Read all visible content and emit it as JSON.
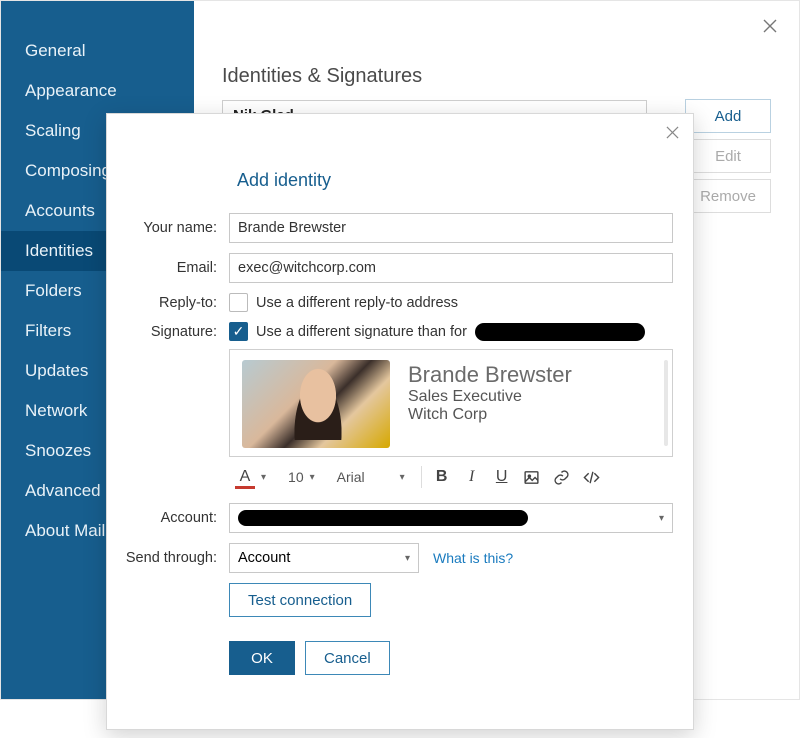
{
  "sidebar": {
    "items": [
      {
        "label": "General"
      },
      {
        "label": "Appearance"
      },
      {
        "label": "Scaling"
      },
      {
        "label": "Composing"
      },
      {
        "label": "Accounts"
      },
      {
        "label": "Identities"
      },
      {
        "label": "Folders"
      },
      {
        "label": "Filters"
      },
      {
        "label": "Updates"
      },
      {
        "label": "Network"
      },
      {
        "label": "Snoozes"
      },
      {
        "label": "Advanced"
      },
      {
        "label": "About Mailbird"
      }
    ],
    "selected_index": 5
  },
  "main": {
    "title": "Identities & Signatures",
    "list_first": "Nik Glad",
    "buttons": {
      "add": "Add",
      "edit": "Edit",
      "remove": "Remove"
    }
  },
  "modal": {
    "title": "Add identity",
    "labels": {
      "name": "Your name:",
      "email": "Email:",
      "reply_to": "Reply-to:",
      "signature": "Signature:",
      "account": "Account:",
      "send_through": "Send through:"
    },
    "your_name_value": "Brande Brewster",
    "email_value": "exec@witchcorp.com",
    "reply_to_checkbox_label": "Use a different reply-to address",
    "signature_checkbox_label": "Use a different signature than for",
    "signature": {
      "name": "Brande Brewster",
      "title": "Sales Executive",
      "company": "Witch Corp"
    },
    "toolbar": {
      "font_size": "10",
      "font_family": "Arial"
    },
    "send_through_value": "Account",
    "what_is_this": "What is this?",
    "buttons": {
      "test": "Test connection",
      "ok": "OK",
      "cancel": "Cancel"
    }
  }
}
